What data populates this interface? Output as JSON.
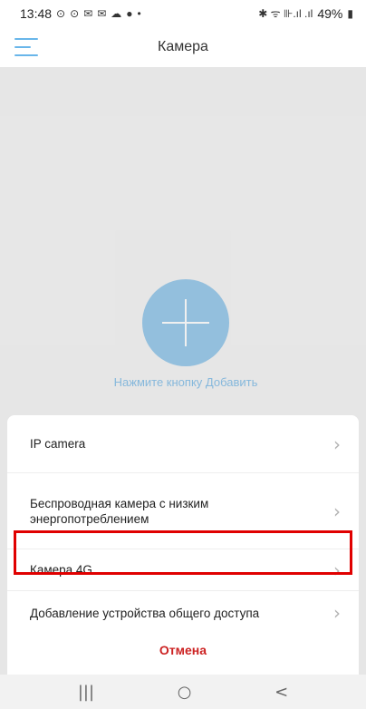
{
  "status_bar": {
    "time": "13:48",
    "notification_icons": [
      "⊙",
      "⊙",
      "✉",
      "✉",
      "☁",
      "●",
      "•"
    ],
    "battery": "49%",
    "signal_text": "✱ ᯤ ⊪.ıl .ıl"
  },
  "app_bar": {
    "title": "Камера"
  },
  "main": {
    "add_hint": "Нажмите кнопку Добавить"
  },
  "sheet": {
    "items": [
      {
        "label": "IP camera"
      },
      {
        "label": "Беспроводная камера с низким энергопотреблением"
      },
      {
        "label": "Камера 4G"
      },
      {
        "label": "Добавление устройства общего доступа"
      }
    ],
    "cancel_label": "Отмена"
  },
  "nav": {
    "recent": "|||",
    "home": "○",
    "back": "<"
  },
  "colors": {
    "accent": "#69b6ea",
    "add_button": "#9dcbeb",
    "cancel": "#cc2222",
    "highlight": "#e00000"
  }
}
